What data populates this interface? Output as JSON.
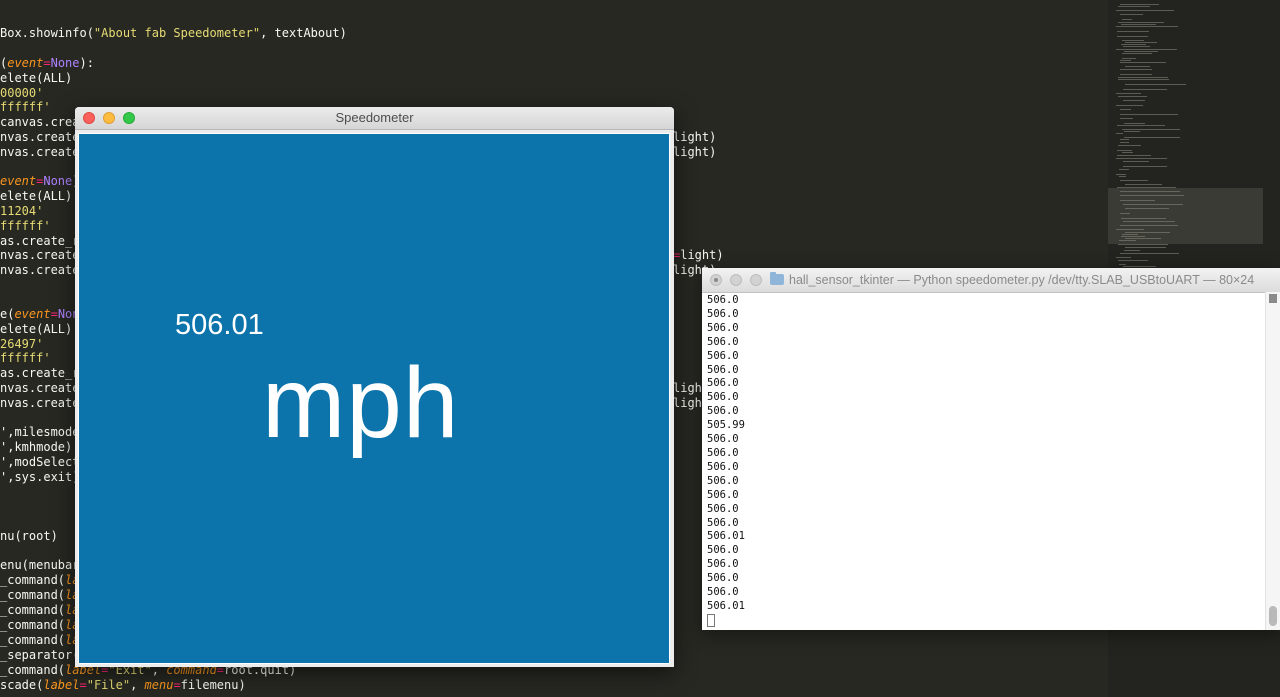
{
  "editor": {
    "lines": [
      {
        "t": 26,
        "segs": [
          [
            "",
            "Box.showinfo("
          ],
          [
            "str",
            "\"About fab Speedometer\""
          ],
          [
            "",
            ", textAbout)"
          ]
        ]
      },
      {
        "t": 56,
        "segs": [
          [
            "",
            "("
          ],
          [
            "kw",
            "event"
          ],
          [
            "pink",
            "="
          ],
          [
            "pur",
            "None"
          ],
          [
            "",
            "):"
          ]
        ]
      },
      {
        "t": 71,
        "segs": [
          [
            "",
            "elete(ALL)"
          ]
        ]
      },
      {
        "t": 86,
        "segs": [
          [
            "str",
            "00000'"
          ]
        ]
      },
      {
        "t": 100,
        "segs": [
          [
            "str",
            "ffffff'"
          ]
        ]
      },
      {
        "t": 115,
        "segs": [
          [
            "",
            "canvas.crea"
          ]
        ]
      },
      {
        "t": 130,
        "segs": [
          [
            "",
            "nvas.create_"
          ]
        ]
      },
      {
        "t": 145,
        "segs": [
          [
            "",
            "nvas.create_"
          ]
        ]
      },
      {
        "t": 174,
        "segs": [
          [
            "kw",
            "event"
          ],
          [
            "pink",
            "="
          ],
          [
            "pur",
            "None"
          ],
          [
            "",
            ")"
          ]
        ]
      },
      {
        "t": 189,
        "segs": [
          [
            "",
            "elete(ALL)"
          ]
        ]
      },
      {
        "t": 204,
        "segs": [
          [
            "str",
            "11204'"
          ]
        ]
      },
      {
        "t": 219,
        "segs": [
          [
            "str",
            "ffffff'"
          ]
        ]
      },
      {
        "t": 234,
        "segs": [
          [
            "",
            "as.create_re"
          ]
        ]
      },
      {
        "t": 248,
        "segs": [
          [
            "",
            "nvas.create_"
          ]
        ]
      },
      {
        "t": 263,
        "segs": [
          [
            "",
            "nvas.create_"
          ]
        ]
      },
      {
        "t": 307,
        "segs": [
          [
            "",
            "e("
          ],
          [
            "kw",
            "event"
          ],
          [
            "pink",
            "="
          ],
          [
            "pur",
            "None"
          ]
        ]
      },
      {
        "t": 322,
        "segs": [
          [
            "",
            "elete(ALL)"
          ]
        ]
      },
      {
        "t": 337,
        "segs": [
          [
            "str",
            "26497'"
          ]
        ]
      },
      {
        "t": 351,
        "segs": [
          [
            "str",
            "ffffff'"
          ]
        ]
      },
      {
        "t": 366,
        "segs": [
          [
            "",
            "as.create_re"
          ]
        ]
      },
      {
        "t": 381,
        "segs": [
          [
            "",
            "nvas.create_"
          ]
        ]
      },
      {
        "t": 396,
        "segs": [
          [
            "",
            "nvas.create_"
          ]
        ]
      },
      {
        "t": 425,
        "segs": [
          [
            "",
            "',milesmode"
          ]
        ]
      },
      {
        "t": 440,
        "segs": [
          [
            "",
            "',kmhmode)"
          ]
        ]
      },
      {
        "t": 455,
        "segs": [
          [
            "",
            "',modSelect"
          ]
        ]
      },
      {
        "t": 470,
        "segs": [
          [
            "",
            "',sys.exit)"
          ]
        ]
      },
      {
        "t": 529,
        "segs": [
          [
            "",
            "nu(root)"
          ]
        ]
      },
      {
        "t": 558,
        "segs": [
          [
            "",
            "enu(menubar"
          ]
        ]
      },
      {
        "t": 573,
        "segs": [
          [
            "",
            "_command("
          ],
          [
            "kw",
            "lab"
          ]
        ]
      },
      {
        "t": 588,
        "segs": [
          [
            "",
            "_command("
          ],
          [
            "kw",
            "lab"
          ]
        ]
      },
      {
        "t": 603,
        "segs": [
          [
            "",
            "_command("
          ],
          [
            "kw",
            "lab"
          ]
        ]
      },
      {
        "t": 618,
        "segs": [
          [
            "",
            "_command("
          ],
          [
            "kw",
            "lab"
          ]
        ]
      },
      {
        "t": 633,
        "segs": [
          [
            "",
            "_command("
          ],
          [
            "kw",
            "lab"
          ]
        ]
      },
      {
        "t": 648,
        "segs": [
          [
            "",
            "_separator("
          ]
        ]
      },
      {
        "t": 663,
        "segs": [
          [
            "",
            "_command("
          ],
          [
            "kw",
            "label"
          ],
          [
            "pink",
            "="
          ],
          [
            "str",
            "\"Exit\""
          ],
          [
            "",
            ", "
          ],
          [
            "kw",
            "command"
          ],
          [
            "pink",
            "="
          ],
          [
            "",
            "root.quit)"
          ]
        ]
      },
      {
        "t": 678,
        "segs": [
          [
            "",
            "scade("
          ],
          [
            "kw",
            "label"
          ],
          [
            "pink",
            "="
          ],
          [
            "str",
            "\"File\""
          ],
          [
            "",
            ", "
          ],
          [
            "kw",
            "menu"
          ],
          [
            "pink",
            "="
          ],
          [
            "",
            "filemenu)"
          ]
        ]
      }
    ],
    "right_lines": [
      {
        "t": 130,
        "segs": [
          [
            "",
            "light)"
          ]
        ]
      },
      {
        "t": 145,
        "segs": [
          [
            "",
            "light)"
          ]
        ]
      },
      {
        "t": 248,
        "segs": [
          [
            "pink",
            "="
          ],
          [
            "",
            "light)"
          ]
        ]
      },
      {
        "t": 263,
        "segs": [
          [
            "",
            "light)"
          ]
        ]
      },
      {
        "t": 381,
        "segs": [
          [
            "",
            "light)"
          ]
        ]
      },
      {
        "t": 396,
        "segs": [
          [
            "",
            "light)"
          ]
        ]
      }
    ]
  },
  "speedometer": {
    "title": "Speedometer",
    "value": "506.01",
    "unit": "mph",
    "canvas_color": "#0c74aa"
  },
  "terminal": {
    "title": "hall_sensor_tkinter — Python speedometer.py /dev/tty.SLAB_USBtoUART — 80×24",
    "output": [
      "506.0",
      "506.0",
      "506.0",
      "506.0",
      "506.0",
      "506.0",
      "506.0",
      "506.0",
      "506.0",
      "505.99",
      "506.0",
      "506.0",
      "506.0",
      "506.0",
      "506.0",
      "506.0",
      "506.0",
      "506.01",
      "506.0",
      "506.0",
      "506.0",
      "506.0",
      "506.01"
    ]
  },
  "icons": {
    "close": "close-icon",
    "minimize": "minimize-icon",
    "zoom": "zoom-icon",
    "folder": "folder-icon"
  }
}
